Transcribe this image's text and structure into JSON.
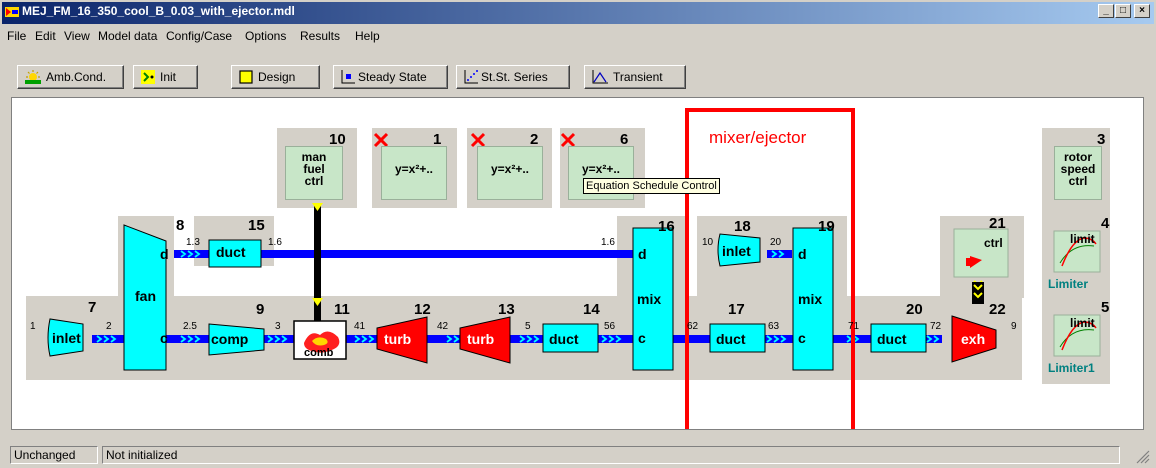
{
  "window": {
    "title": "MEJ_FM_16_350_cool_B_0.03_with_ejector.mdl",
    "min_label": "_",
    "max_label": "□",
    "close_label": "×"
  },
  "menu": [
    "File",
    "Edit",
    "View",
    "Model data",
    "Config/Case",
    "Options",
    "Results",
    "Help"
  ],
  "toolbar": {
    "amb_cond": "Amb.Cond.",
    "init": "Init",
    "design": "Design",
    "steady_state": "Steady State",
    "st_st_series": "St.St. Series",
    "transient": "Transient"
  },
  "model": {
    "components": {
      "inlet7": {
        "num": "7",
        "label": "inlet"
      },
      "fan8": {
        "num": "8",
        "label": "fan",
        "d": "d",
        "c": "c"
      },
      "duct15": {
        "num": "15",
        "label": "duct"
      },
      "comp9": {
        "num": "9",
        "label": "comp"
      },
      "comb11": {
        "num": "11",
        "label": "comb"
      },
      "turb12": {
        "num": "12",
        "label": "turb"
      },
      "turb13": {
        "num": "13",
        "label": "turb"
      },
      "duct14": {
        "num": "14",
        "label": "duct"
      },
      "mix16": {
        "num": "16",
        "label": "mix",
        "d": "d",
        "c": "c"
      },
      "inlet18": {
        "num": "18",
        "label": "inlet"
      },
      "duct17": {
        "num": "17",
        "label": "duct"
      },
      "mix19": {
        "num": "19",
        "label": "mix",
        "d": "d",
        "c": "c"
      },
      "duct20": {
        "num": "20",
        "label": "duct"
      },
      "exh22": {
        "num": "22",
        "label": "exh"
      },
      "ctrl10": {
        "num": "10",
        "label": "man fuel ctrl"
      },
      "eq1": {
        "num": "1",
        "label": "y=x²+.."
      },
      "eq2": {
        "num": "2",
        "label": "y=x²+.."
      },
      "eq6": {
        "num": "6",
        "label": "y=x²+.."
      },
      "ctrl21": {
        "num": "21",
        "label": "ctrl"
      },
      "ctrl3": {
        "num": "3",
        "label": "rotor speed ctrl"
      },
      "lim4": {
        "num": "4",
        "label": "limit",
        "caption": "Limiter"
      },
      "lim5": {
        "num": "5",
        "label": "limit",
        "caption": "Limiter1"
      }
    },
    "stations": {
      "s1": "1",
      "s2": "2",
      "s13": "1.3",
      "s16a": "1.6",
      "s16b": "1.6",
      "s25": "2.5",
      "s3": "3",
      "s41": "41",
      "s42": "42",
      "s5": "5",
      "s56": "56",
      "s62": "62",
      "s63": "63",
      "s10": "10",
      "s20": "20",
      "s71": "71",
      "s72": "72",
      "s9": "9"
    },
    "tooltip": "Equation Schedule Control",
    "annotation": "mixer/ejector"
  },
  "status": {
    "panel1": "Unchanged",
    "panel2": "Not initialized"
  },
  "colors": {
    "cyan": "#00ffff",
    "red": "#ff0000",
    "blue": "#0000ff",
    "green_bg": "#c8e6c8",
    "panel_gray": "#d4d0c8"
  }
}
